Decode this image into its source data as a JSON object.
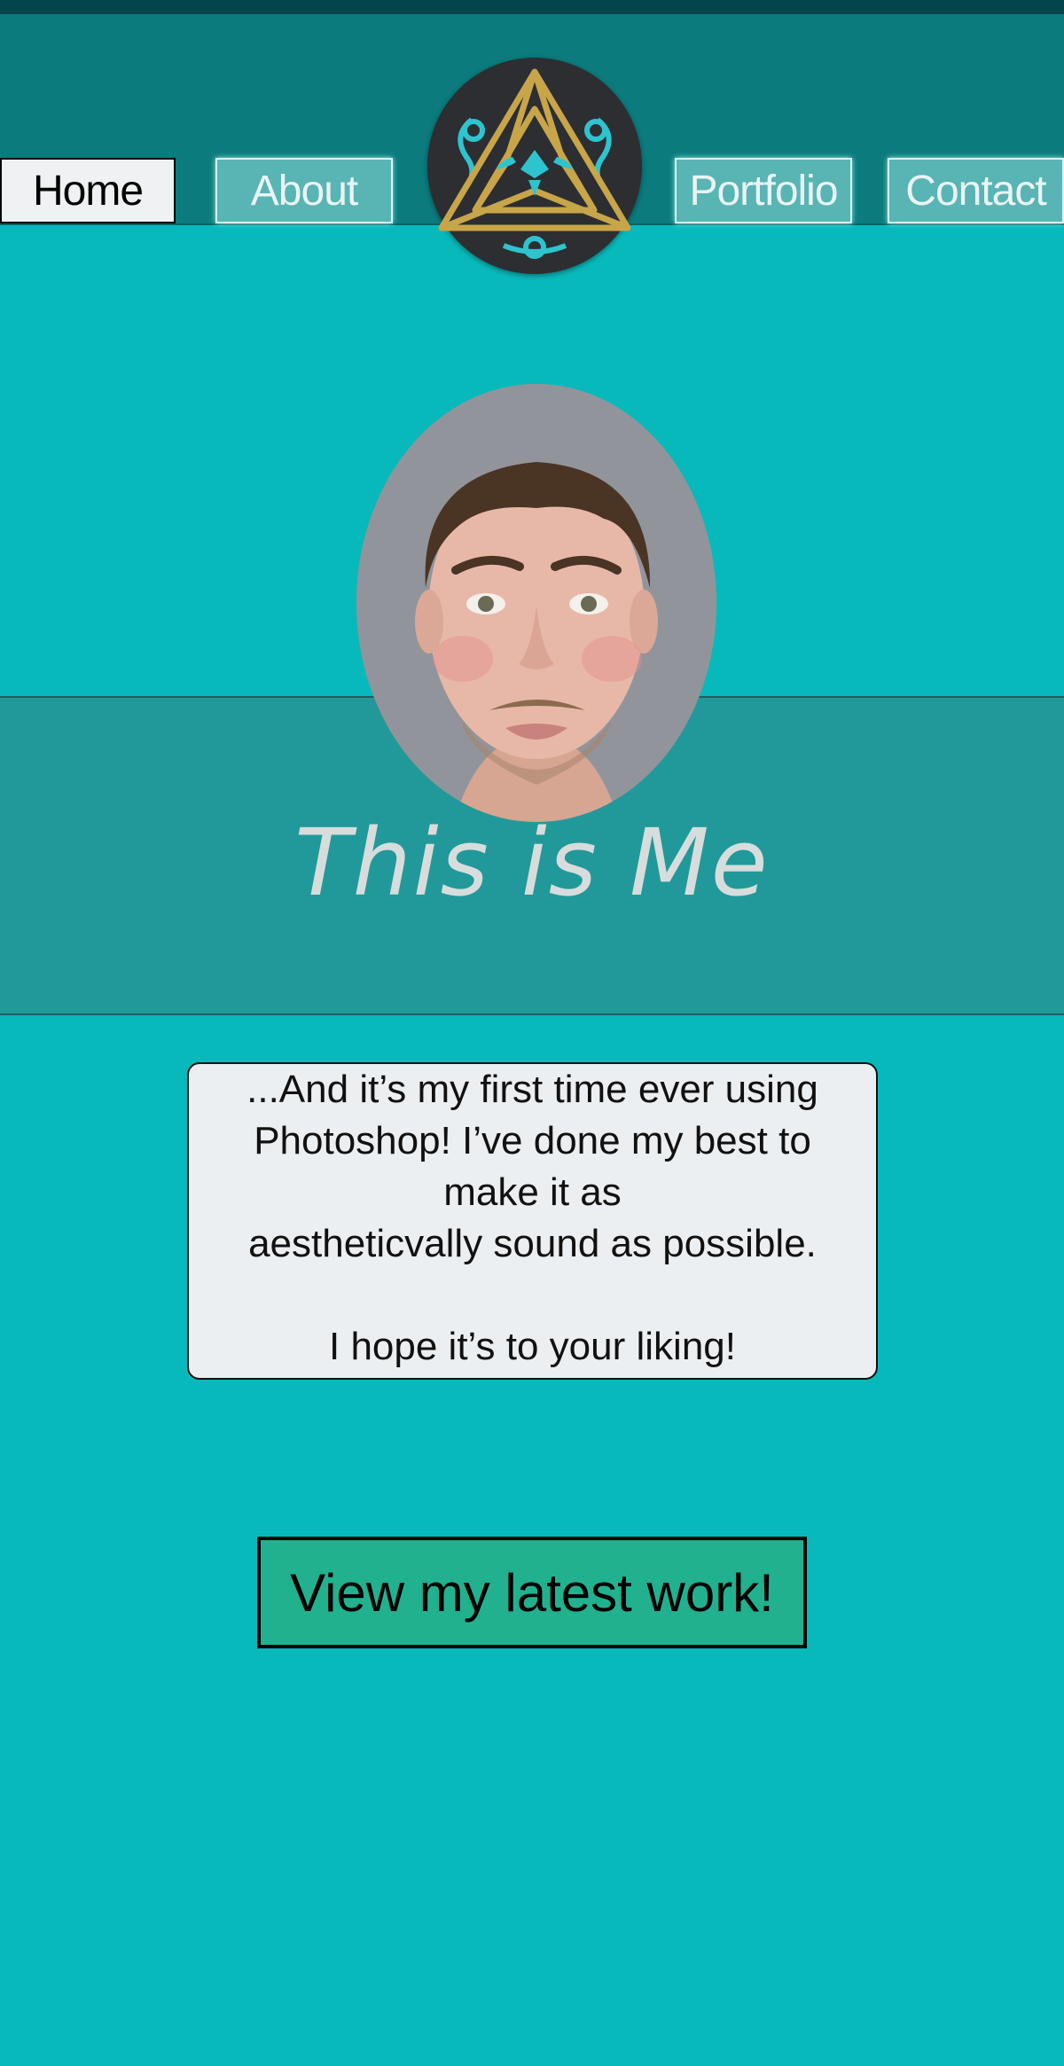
{
  "nav": {
    "items": [
      {
        "label": "Home",
        "active": true
      },
      {
        "label": "About",
        "active": false
      },
      {
        "label": "Portfolio",
        "active": false
      },
      {
        "label": "Contact",
        "active": false
      }
    ]
  },
  "logo": {
    "icon": "celtic-triforce-icon"
  },
  "hero": {
    "title": "This is Me",
    "portrait": "portrait-photo"
  },
  "intro": {
    "line1": "...And it’s my first time ever using",
    "line2": "Photoshop! I’ve done my best to",
    "line3": "make it as",
    "line4": "aestheticvally sound as possible.",
    "line5": "I hope it’s to your liking!"
  },
  "cta": {
    "label": "View my latest work!"
  },
  "colors": {
    "background": "#08b9bb",
    "header": "#0b7b7d",
    "band": "#21999a",
    "button": "#22b18f",
    "nav_inactive": "#59b4b4"
  }
}
